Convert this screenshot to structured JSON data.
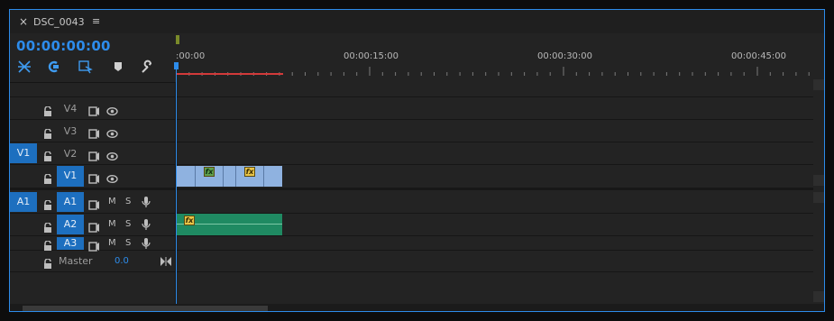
{
  "panel": {
    "close_glyph": "×",
    "sequence_name": "DSC_0043",
    "menu_glyph": "≡",
    "playhead_timecode": "00:00:00:00"
  },
  "tools": [
    {
      "name": "snap-icon"
    },
    {
      "name": "linked-selection-icon"
    },
    {
      "name": "add-marker-icon"
    },
    {
      "name": "marker-icon"
    },
    {
      "name": "wrench-icon"
    }
  ],
  "ruler": {
    "labels": [
      ":00:00",
      "00:00:15:00",
      "00:00:30:00",
      "00:00:45:00"
    ]
  },
  "video_tracks": [
    {
      "source": "",
      "name": "V4"
    },
    {
      "source": "",
      "name": "V3"
    },
    {
      "source": "V1",
      "name": "V2"
    },
    {
      "source": "",
      "name": "V1"
    }
  ],
  "audio_tracks": [
    {
      "source": "A1",
      "name": "A1",
      "mute": "M",
      "solo": "S"
    },
    {
      "source": "",
      "name": "A2",
      "mute": "M",
      "solo": "S"
    },
    {
      "source": "",
      "name": "A3",
      "mute": "M",
      "solo": "S"
    }
  ],
  "master": {
    "label": "Master",
    "value": "0.0"
  },
  "clips": {
    "video_fx": [
      "fx",
      "fx"
    ],
    "audio_fx": [
      "fx"
    ]
  },
  "colors": {
    "accent": "#2d8ceb",
    "target_track": "#1d6fbf",
    "video_clip": "#8fb2e0",
    "audio_clip": "#1f8a62",
    "fx_badge": "#e8c448",
    "work_area": "#d23a3a"
  }
}
